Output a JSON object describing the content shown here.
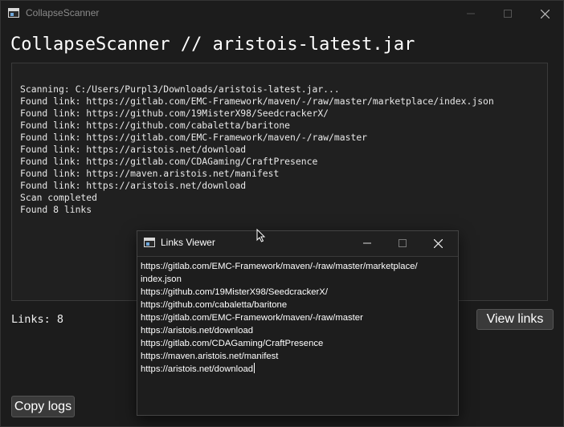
{
  "window": {
    "title": "CollapseScanner",
    "heading": "CollapseScanner // aristois-latest.jar"
  },
  "log": {
    "lines": [
      "Scanning: C:/Users/Purpl3/Downloads/aristois-latest.jar...",
      "Found link: https://gitlab.com/EMC-Framework/maven/-/raw/master/marketplace/index.json",
      "Found link: https://github.com/19MisterX98/SeedcrackerX/",
      "Found link: https://github.com/cabaletta/baritone",
      "Found link: https://gitlab.com/EMC-Framework/maven/-/raw/master",
      "Found link: https://aristois.net/download",
      "Found link: https://gitlab.com/CDAGaming/CraftPresence",
      "Found link: https://maven.aristois.net/manifest",
      "Found link: https://aristois.net/download",
      "Scan completed",
      "Found 8 links"
    ]
  },
  "status": {
    "links_label": "Links: 8"
  },
  "buttons": {
    "view_links": "View links",
    "copy_logs": "Copy logs"
  },
  "dialog": {
    "title": "Links Viewer",
    "lines": [
      "https://gitlab.com/EMC-Framework/maven/-/raw/master/marketplace/",
      "index.json",
      "https://github.com/19MisterX98/SeedcrackerX/",
      "https://github.com/cabaletta/baritone",
      "https://gitlab.com/EMC-Framework/maven/-/raw/master",
      "https://aristois.net/download",
      "https://gitlab.com/CDAGaming/CraftPresence",
      "https://maven.aristois.net/manifest",
      "https://aristois.net/download"
    ]
  },
  "icons": {
    "app": "window-app-icon",
    "minimize": "minimize-icon",
    "maximize": "maximize-icon",
    "close": "close-icon",
    "cursor": "mouse-pointer-icon"
  },
  "colors": {
    "background": "#1c1c1c",
    "panel": "#202020",
    "button": "#3a3a3a",
    "text": "#ffffff"
  }
}
